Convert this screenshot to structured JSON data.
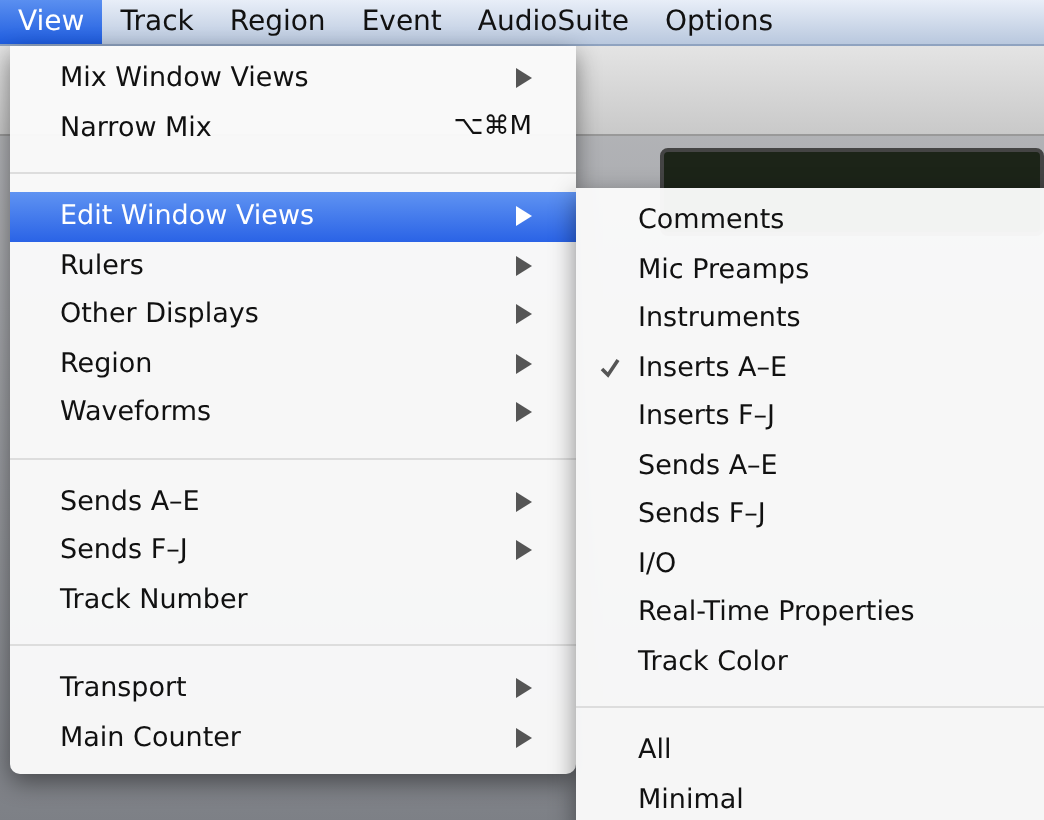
{
  "menu_bar": [
    {
      "label": "View",
      "selected": true
    },
    {
      "label": "Track",
      "selected": false
    },
    {
      "label": "Region",
      "selected": false
    },
    {
      "label": "Event",
      "selected": false
    },
    {
      "label": "AudioSuite",
      "selected": false
    },
    {
      "label": "Options",
      "selected": false
    }
  ],
  "view_menu": {
    "items": [
      {
        "kind": "submenu",
        "label": "Mix Window Views",
        "selected": false
      },
      {
        "kind": "shortcut",
        "label": "Narrow Mix",
        "shortcut": "⌥⌘M",
        "selected": false
      },
      {
        "kind": "separator"
      },
      {
        "kind": "submenu",
        "label": "Edit Window Views",
        "selected": true
      },
      {
        "kind": "submenu",
        "label": "Rulers",
        "selected": false
      },
      {
        "kind": "submenu",
        "label": "Other Displays",
        "selected": false
      },
      {
        "kind": "submenu",
        "label": "Region",
        "selected": false
      },
      {
        "kind": "submenu",
        "label": "Waveforms",
        "selected": false
      },
      {
        "kind": "separator"
      },
      {
        "kind": "submenu",
        "label": "Sends A–E",
        "selected": false
      },
      {
        "kind": "submenu",
        "label": "Sends F–J",
        "selected": false
      },
      {
        "kind": "plain",
        "label": "Track Number",
        "selected": false
      },
      {
        "kind": "separator"
      },
      {
        "kind": "submenu",
        "label": "Transport",
        "selected": false
      },
      {
        "kind": "submenu",
        "label": "Main Counter",
        "selected": false
      }
    ]
  },
  "edit_window_views_submenu": {
    "items": [
      {
        "kind": "item",
        "label": "Comments",
        "checked": false
      },
      {
        "kind": "item",
        "label": "Mic Preamps",
        "checked": false
      },
      {
        "kind": "item",
        "label": "Instruments",
        "checked": false
      },
      {
        "kind": "item",
        "label": "Inserts A–E",
        "checked": true
      },
      {
        "kind": "item",
        "label": "Inserts F–J",
        "checked": false
      },
      {
        "kind": "item",
        "label": "Sends A–E",
        "checked": false
      },
      {
        "kind": "item",
        "label": "Sends F–J",
        "checked": false
      },
      {
        "kind": "item",
        "label": "I/O",
        "checked": false
      },
      {
        "kind": "item",
        "label": "Real-Time Properties",
        "checked": false
      },
      {
        "kind": "item",
        "label": "Track Color",
        "checked": false
      },
      {
        "kind": "separator"
      },
      {
        "kind": "item",
        "label": "All",
        "checked": false
      },
      {
        "kind": "item",
        "label": "Minimal",
        "checked": false
      }
    ]
  }
}
